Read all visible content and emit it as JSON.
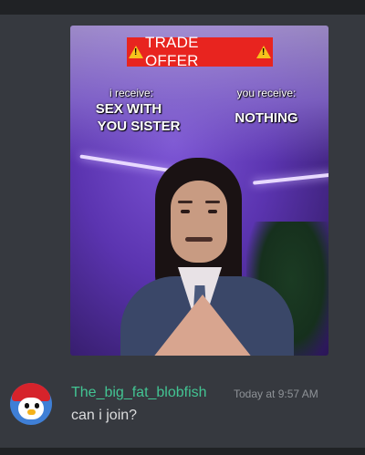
{
  "meme": {
    "banner": "TRADE OFFER",
    "left_label": "i receive:",
    "left_value_line1": "SEX WITH",
    "left_value_line2": "YOU SISTER",
    "right_label": "you receive:",
    "right_value": "NOTHING"
  },
  "message": {
    "username": "The_big_fat_blobfish",
    "timestamp": "Today at 9:57 AM",
    "text": "can i join?",
    "username_color": "#43c493"
  },
  "colors": {
    "background": "#36393f",
    "banner": "#e8241f",
    "warning_icon": "#f6c21c"
  }
}
